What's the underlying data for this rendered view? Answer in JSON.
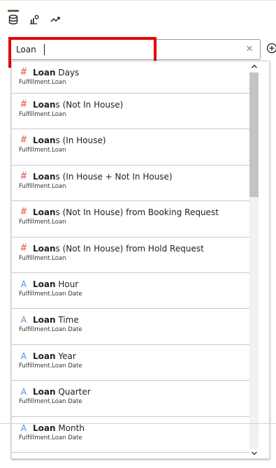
{
  "toolbar": {
    "buttons": [
      {
        "name": "data-icon"
      },
      {
        "name": "visualizations-icon"
      },
      {
        "name": "analytics-icon"
      }
    ]
  },
  "search": {
    "value": "Loan",
    "placeholder": ""
  },
  "results": [
    {
      "icon": "#",
      "type": "measure",
      "match": "Loan",
      "rest": " Days",
      "subtitle": "Fulfillment.Loan"
    },
    {
      "icon": "#",
      "type": "measure",
      "match": "Loan",
      "rest": "s (Not In House)",
      "subtitle": "Fulfillment.Loan"
    },
    {
      "icon": "#",
      "type": "measure",
      "match": "Loan",
      "rest": "s (In House)",
      "subtitle": "Fulfillment.Loan"
    },
    {
      "icon": "#",
      "type": "measure",
      "match": "Loan",
      "rest": "s (In House + Not In House)",
      "subtitle": "Fulfillment.Loan"
    },
    {
      "icon": "#",
      "type": "measure",
      "match": "Loan",
      "rest": "s (Not In House) from Booking Request",
      "subtitle": "Fulfillment.Loan"
    },
    {
      "icon": "#",
      "type": "measure",
      "match": "Loan",
      "rest": "s (Not In House) from Hold Request",
      "subtitle": "Fulfillment.Loan"
    },
    {
      "icon": "A",
      "type": "attribute",
      "match": "Loan",
      "rest": " Hour",
      "subtitle": "Fulfillment.Loan Date"
    },
    {
      "icon": "A",
      "type": "attribute",
      "match": "Loan",
      "rest": " Time",
      "subtitle": "Fulfillment.Loan Date"
    },
    {
      "icon": "A",
      "type": "attribute",
      "match": "Loan",
      "rest": " Year",
      "subtitle": "Fulfillment.Loan Date"
    },
    {
      "icon": "A",
      "type": "attribute",
      "match": "Loan",
      "rest": " Quarter",
      "subtitle": "Fulfillment.Loan Date"
    },
    {
      "icon": "A",
      "type": "attribute",
      "match": "Loan",
      "rest": " Month",
      "subtitle": "Fulfillment.Loan Date"
    }
  ],
  "colors": {
    "measure_icon": "#e2574c",
    "attribute_icon": "#5b8fc7",
    "highlight": "#e80000",
    "active_tab": "#4b6d3f"
  }
}
